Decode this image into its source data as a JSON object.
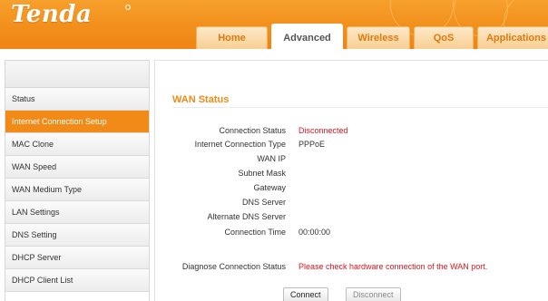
{
  "brand": {
    "logo_text": "Tenda"
  },
  "nav": {
    "tabs": [
      {
        "label": "Home",
        "active": false
      },
      {
        "label": "Advanced",
        "active": true
      },
      {
        "label": "Wireless",
        "active": false
      },
      {
        "label": "QoS",
        "active": false
      },
      {
        "label": "Applications",
        "active": false
      }
    ]
  },
  "sidebar": {
    "items": [
      {
        "label": "Status",
        "active": false
      },
      {
        "label": "Internet Connection Setup",
        "active": true
      },
      {
        "label": "MAC Clone",
        "active": false
      },
      {
        "label": "WAN Speed",
        "active": false
      },
      {
        "label": "WAN Medium Type",
        "active": false
      },
      {
        "label": "LAN Settings",
        "active": false
      },
      {
        "label": "DNS Setting",
        "active": false
      },
      {
        "label": "DHCP Server",
        "active": false
      },
      {
        "label": "DHCP Client List",
        "active": false
      }
    ]
  },
  "wan_status": {
    "title": "WAN Status",
    "rows": [
      {
        "label": "Connection Status",
        "value": "Disconnected",
        "alert": true
      },
      {
        "label": "Internet Connection Type",
        "value": "PPPoE",
        "alert": false
      },
      {
        "label": "WAN IP",
        "value": "",
        "alert": false
      },
      {
        "label": "Subnet Mask",
        "value": "",
        "alert": false
      },
      {
        "label": "Gateway",
        "value": "",
        "alert": false
      },
      {
        "label": "DNS Server",
        "value": "",
        "alert": false
      },
      {
        "label": "Alternate DNS Server",
        "value": "",
        "alert": false
      },
      {
        "label": "Connection Time",
        "value": "00:00:00",
        "alert": false
      }
    ],
    "diagnose": {
      "label": "Diagnose Connection Status",
      "value": "Please check hardware connection of the WAN port."
    },
    "buttons": {
      "connect": "Connect",
      "disconnect": "Disconnect"
    }
  },
  "colors": {
    "brand_orange": "#f28a18",
    "alert_red": "#e0141e",
    "title_orange": "#f08a14"
  }
}
